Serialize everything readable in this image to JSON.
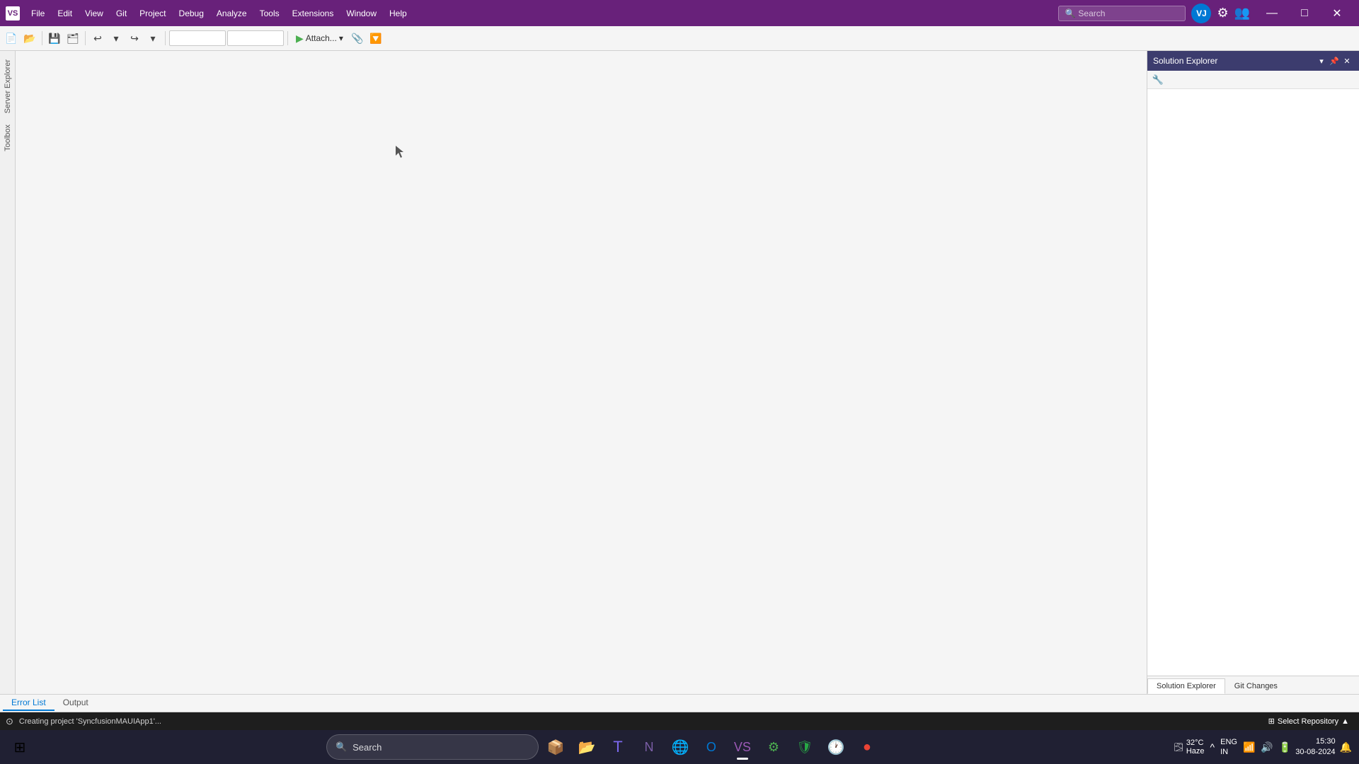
{
  "titlebar": {
    "logo_text": "VS",
    "menu_items": [
      "File",
      "Edit",
      "View",
      "Git",
      "Project",
      "Debug",
      "Analyze",
      "Tools",
      "Extensions",
      "Window",
      "Help"
    ],
    "search_placeholder": "Search",
    "search_label": "Search",
    "user_avatar": "VJ",
    "github_icon": "⚙",
    "win_minimize": "—",
    "win_maximize": "□",
    "win_close": "✕"
  },
  "toolbar": {
    "attach_label": "Attach...",
    "dropdown1_value": "",
    "dropdown2_value": ""
  },
  "left_panels": {
    "server_explorer": "Server Explorer",
    "toolbox": "Toolbox"
  },
  "solution_explorer": {
    "title": "Solution Explorer",
    "pin_icon": "📌",
    "dock_icon": "▾",
    "close_icon": "✕",
    "tools_icon": "🔧",
    "tab_solution": "Solution Explorer",
    "tab_git": "Git Changes"
  },
  "bottom": {
    "tab_error_list": "Error List",
    "tab_output": "Output"
  },
  "status_bar": {
    "progress_icon": "⊙",
    "progress_text": "Creating project 'SyncfusionMAUIApp1'...",
    "select_repo_label": "Select Repository",
    "select_repo_icon": "⊞",
    "arrow_up": "▲"
  },
  "taskbar": {
    "start_icon": "⊞",
    "search_icon": "🔍",
    "search_text": "Search",
    "apps": [
      {
        "name": "files-app",
        "icon": "📁",
        "active": false
      },
      {
        "name": "explorer-app",
        "icon": "📂",
        "active": false
      },
      {
        "name": "teams-app",
        "icon": "💜",
        "active": false
      },
      {
        "name": "onenote-app",
        "icon": "🟣",
        "active": false
      },
      {
        "name": "chrome-app",
        "icon": "🌐",
        "active": false
      },
      {
        "name": "outlook-app",
        "icon": "📧",
        "active": false
      },
      {
        "name": "vs-app",
        "icon": "💜",
        "active": true
      },
      {
        "name": "github-app",
        "icon": "🐙",
        "active": false
      },
      {
        "name": "kaspersky-app",
        "icon": "🛡",
        "active": false
      },
      {
        "name": "clock-app",
        "icon": "🕐",
        "active": false
      },
      {
        "name": "chrome2-app",
        "icon": "🌐",
        "active": false
      }
    ],
    "tray": {
      "chevron": "^",
      "network": "wifi",
      "volume": "🔊",
      "battery": "🔋",
      "time": "15:30",
      "date": "30-08-2024",
      "language_top": "ENG",
      "language_bottom": "IN",
      "notification": "🔔"
    },
    "weather": {
      "icon": "🌫",
      "temp": "32°C",
      "desc": "Haze"
    }
  }
}
